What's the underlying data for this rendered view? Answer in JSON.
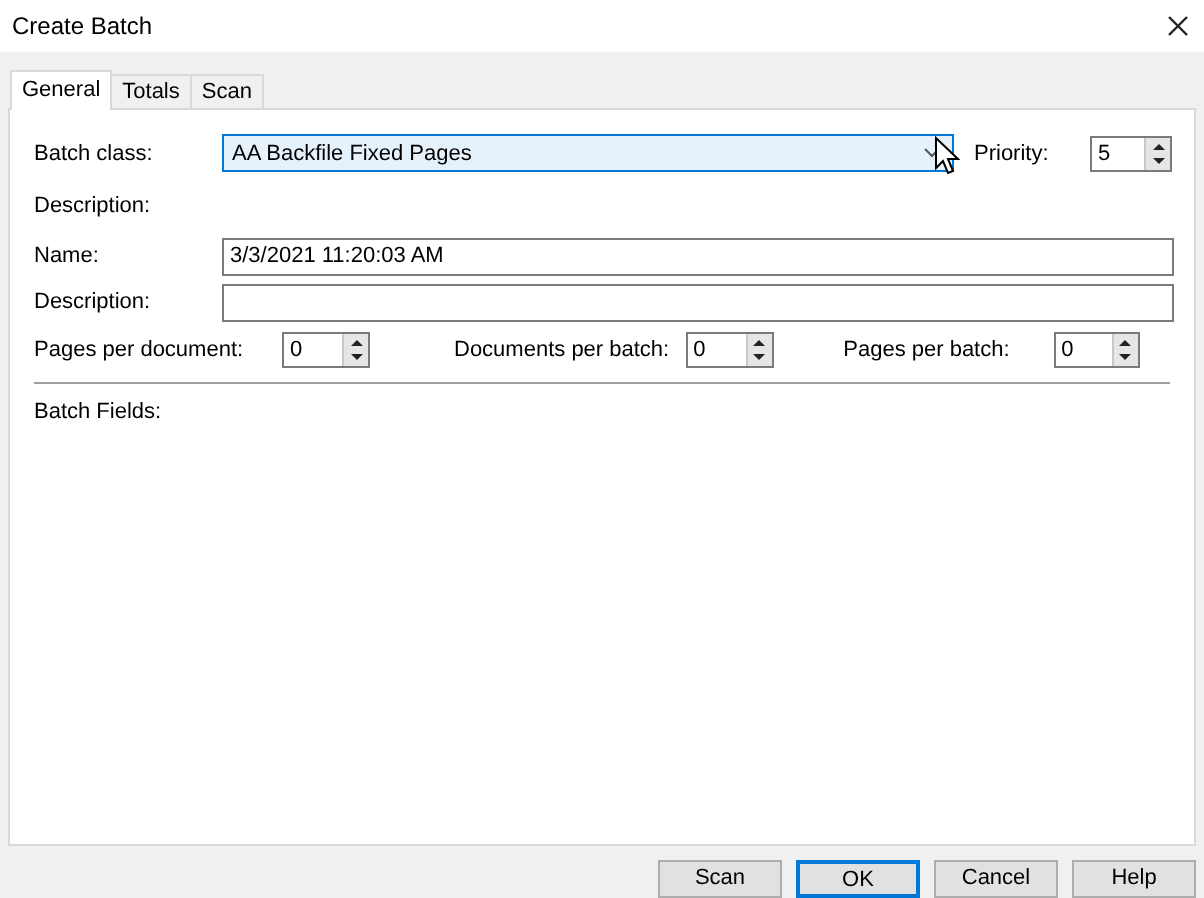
{
  "window": {
    "title": "Create Batch"
  },
  "tabs": [
    {
      "label": "General",
      "selected": true
    },
    {
      "label": "Totals",
      "selected": false
    },
    {
      "label": "Scan",
      "selected": false
    }
  ],
  "batch_class": {
    "label": "Batch class:",
    "value": "AA Backfile Fixed Pages",
    "focused": true
  },
  "priority": {
    "label": "Priority:",
    "value": "5"
  },
  "class_description_label": "Description:",
  "name": {
    "label": "Name:",
    "value": "3/3/2021 11:20:03 AM"
  },
  "description": {
    "label": "Description:"
  },
  "counts": [
    {
      "label": "Pages per document:",
      "value": "0"
    },
    {
      "label": "Documents per batch:",
      "value": "0"
    },
    {
      "label": "Pages per batch:",
      "value": "0"
    }
  ],
  "batch_fields_label": "Batch Fields:",
  "buttons": [
    {
      "label": "Scan",
      "default": false
    },
    {
      "label": "OK",
      "default": true
    },
    {
      "label": "Cancel",
      "default": false
    },
    {
      "label": "Help",
      "default": false
    }
  ]
}
